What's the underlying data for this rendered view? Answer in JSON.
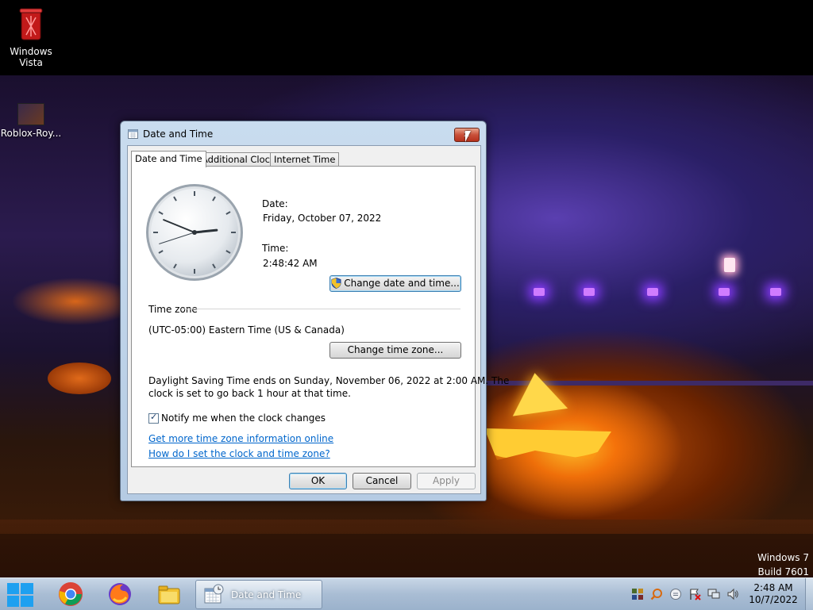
{
  "desktop": {
    "icons": [
      {
        "label": "Windows\nVista",
        "icon": "recycle-bin-icon"
      },
      {
        "label": "Roblox-Roy...",
        "icon": "roblox-icon"
      }
    ],
    "watermark": {
      "line1": "Windows 7",
      "line2": "Build 7601"
    }
  },
  "window": {
    "title": "Date and Time",
    "close_label": "✕",
    "tabs": [
      {
        "label": "Date and Time",
        "active": true
      },
      {
        "label": "Additional Clocks",
        "active": false
      },
      {
        "label": "Internet Time",
        "active": false
      }
    ],
    "date_label": "Date:",
    "date_value": "Friday, October 07, 2022",
    "time_label": "Time:",
    "time_value": "2:48:42 AM",
    "clock": {
      "hour": 2,
      "minute": 48,
      "second": 42
    },
    "change_datetime_button": "Change date and time...",
    "timezone_heading": "Time zone",
    "timezone_value": "(UTC-05:00) Eastern Time (US & Canada)",
    "change_timezone_button": "Change time zone...",
    "dst_line1": "Daylight Saving Time ends on Sunday, November 06, 2022 at 2:00 AM. The",
    "dst_line2": "clock is set to go back 1 hour at that time.",
    "notify_checkbox_label": "Notify me when the clock changes",
    "notify_checked": true,
    "link_more_info": "Get more time zone information online",
    "link_how_to": "How do I set the clock and time zone?",
    "ok_button": "OK",
    "cancel_button": "Cancel",
    "apply_button": "Apply"
  },
  "taskbar": {
    "pinned": [
      "chrome-icon",
      "firefox-icon",
      "file-explorer-icon"
    ],
    "active_task": "Date and Time",
    "tray_time": "2:48 AM",
    "tray_date": "10/7/2022"
  },
  "colors": {
    "link": "#0066cc",
    "taskbar": "#a9bdd4",
    "window_frame": "#c9dcef"
  }
}
